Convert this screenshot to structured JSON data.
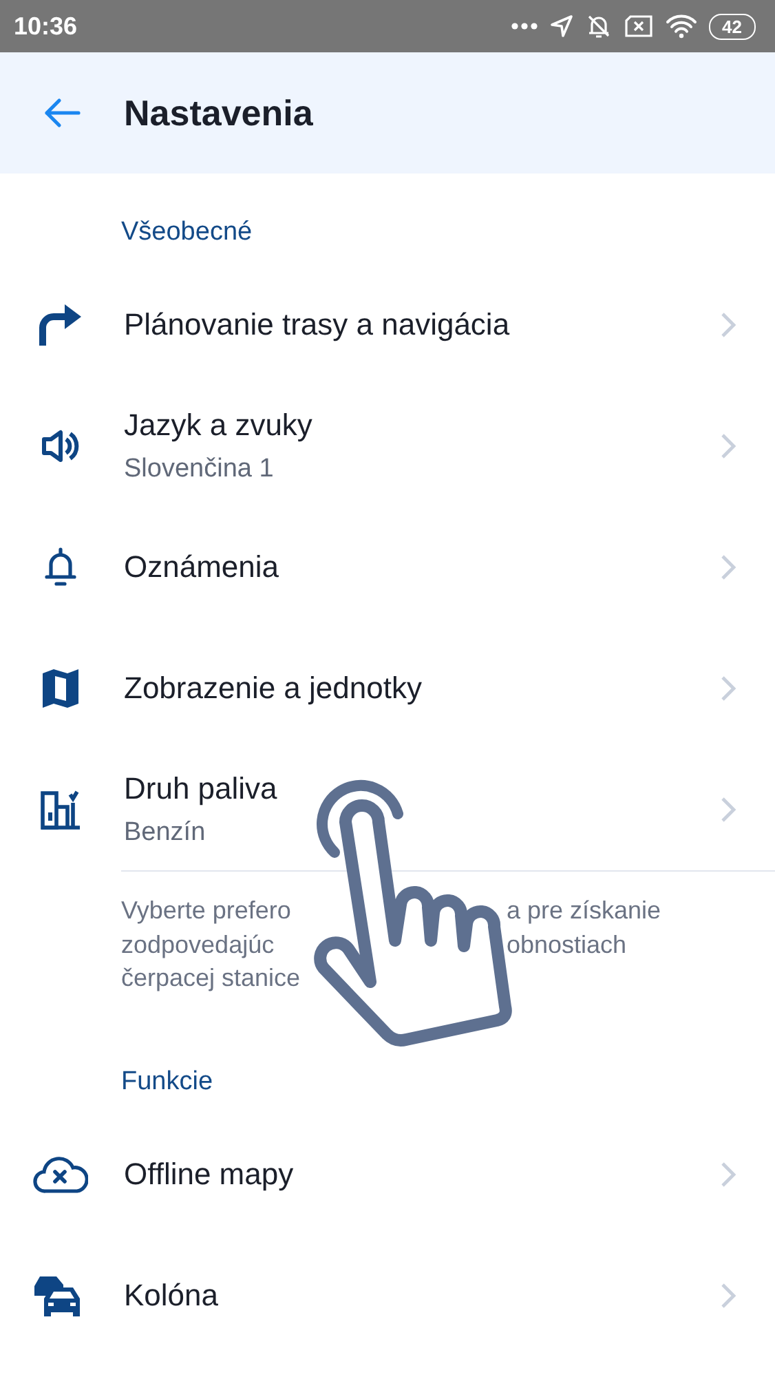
{
  "status_bar": {
    "time": "10:36",
    "battery": "42"
  },
  "header": {
    "title": "Nastavenia"
  },
  "sections": [
    {
      "title": "Všeobecné",
      "items": [
        {
          "kind": "turn",
          "label": "Plánovanie trasy a navigácia"
        },
        {
          "kind": "sound",
          "label": "Jazyk a zvuky",
          "subtitle": "Slovenčina 1"
        },
        {
          "kind": "bell",
          "label": "Oznámenia"
        },
        {
          "kind": "map",
          "label": "Zobrazenie a jednotky"
        },
        {
          "kind": "fuel",
          "label": "Druh paliva",
          "subtitle": "Benzín",
          "note_lines": [
            [
              "Vyberte prefero",
              "a pre získanie"
            ],
            [
              "zodpovedajúc",
              "obnostiach"
            ],
            [
              "čerpacej stanice"
            ]
          ]
        }
      ]
    },
    {
      "title": "Funkcie",
      "items": [
        {
          "kind": "cloud",
          "label": "Offline mapy"
        },
        {
          "kind": "cars",
          "label": "Kolóna"
        }
      ]
    }
  ],
  "overlay": {
    "kind": "tap-hand"
  }
}
